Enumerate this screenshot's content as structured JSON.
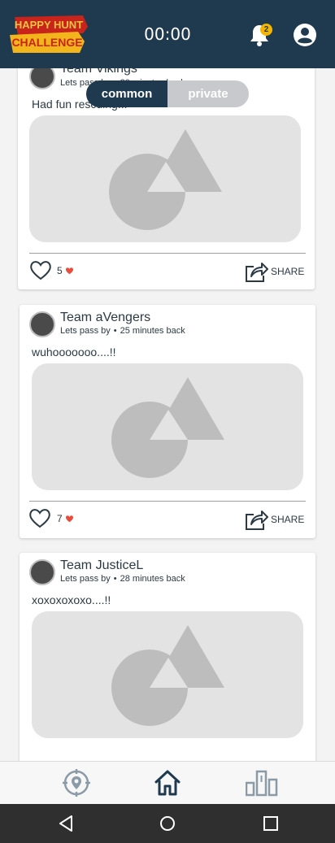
{
  "header": {
    "logo_line1": "HAPPY HUNT",
    "logo_line2": "CHALLENGE",
    "timer": "00:00",
    "notification_count": "2"
  },
  "feed_toggle": {
    "common": "common",
    "private": "private",
    "selected": "common"
  },
  "posts": [
    {
      "team": "Team Vikings",
      "author": "Lets pass by",
      "time": "20 minutes back",
      "message": "Had fun rescuing...",
      "likes": "5",
      "share": "SHARE"
    },
    {
      "team": "Team aVengers",
      "author": "Lets pass by",
      "time": "25 minutes back",
      "message": "wuhooooooo....!!",
      "likes": "7",
      "share": "SHARE"
    },
    {
      "team": "Team JusticeL",
      "author": "Lets pass by",
      "time": "28 minutes back",
      "message": "xoxoxoxoxo....!!"
    }
  ],
  "separator": "•",
  "colors": {
    "header_bg": "#1f3a4f",
    "heart": "#e74c3c",
    "badge": "#f4b400",
    "toggle_off": "#c7c9cc"
  },
  "icons": {
    "bell": "bell-icon",
    "account": "account-circle-icon",
    "like": "heart-outline-icon",
    "share": "share-icon",
    "nav_locate": "target-pin-icon",
    "nav_home": "home-icon",
    "nav_leaderboard": "podium-icon"
  }
}
